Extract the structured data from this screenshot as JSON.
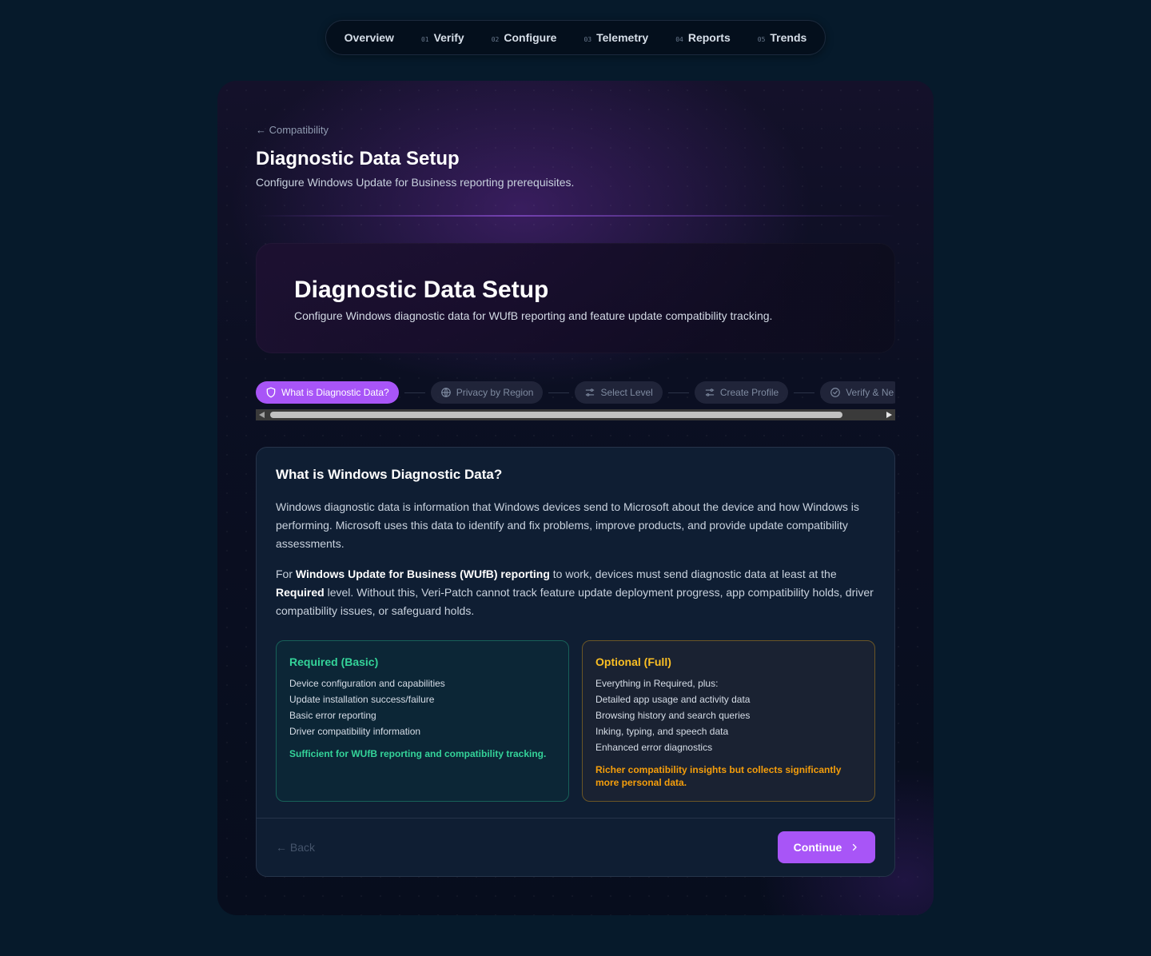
{
  "topnav": {
    "items": [
      {
        "num": "",
        "label": "Overview"
      },
      {
        "num": "01",
        "label": "Verify"
      },
      {
        "num": "02",
        "label": "Configure"
      },
      {
        "num": "03",
        "label": "Telemetry"
      },
      {
        "num": "04",
        "label": "Reports"
      },
      {
        "num": "05",
        "label": "Trends"
      }
    ]
  },
  "header": {
    "breadcrumb": "← Compatibility",
    "title": "Diagnostic Data Setup",
    "subtitle": "Configure Windows Update for Business reporting prerequisites."
  },
  "hero": {
    "title": "Diagnostic Data Setup",
    "subtitle": "Configure Windows diagnostic data for WUfB reporting and feature update compatibility tracking."
  },
  "stepper": {
    "steps": [
      {
        "label": "What is Diagnostic Data?",
        "icon": "shield-icon",
        "active": true
      },
      {
        "label": "Privacy by Region",
        "icon": "globe-icon",
        "active": false
      },
      {
        "label": "Select Level",
        "icon": "sliders-icon",
        "active": false
      },
      {
        "label": "Create Profile",
        "icon": "sliders-icon",
        "active": false
      },
      {
        "label": "Verify & Ne",
        "icon": "check-circle-icon",
        "active": false
      }
    ]
  },
  "panel": {
    "heading": "What is Windows Diagnostic Data?",
    "para1": "Windows diagnostic data is information that Windows devices send to Microsoft about the device and how Windows is performing. Microsoft uses this data to identify and fix problems, improve products, and provide update compatibility assessments.",
    "para2": {
      "t1": "For ",
      "b1": "Windows Update for Business (WUfB) reporting",
      "t2": " to work, devices must send diagnostic data at least at the ",
      "b2": "Required",
      "t3": " level. Without this, Veri-Patch cannot track feature update deployment progress, app compatibility holds, driver compatibility issues, or safeguard holds."
    },
    "required": {
      "title": "Required (Basic)",
      "items": [
        "Device configuration and capabilities",
        "Update installation success/failure",
        "Basic error reporting",
        "Driver compatibility information"
      ],
      "note": "Sufficient for WUfB reporting and compatibility tracking."
    },
    "optional": {
      "title": "Optional (Full)",
      "items": [
        "Everything in Required, plus:",
        "Detailed app usage and activity data",
        "Browsing history and search queries",
        "Inking, typing, and speech data",
        "Enhanced error diagnostics"
      ],
      "note": "Richer compatibility insights but collects significantly more personal data."
    },
    "back_label": "← Back",
    "continue_label": "Continue"
  },
  "colors": {
    "accent": "#a855f7",
    "required": "#34d399",
    "optional": "#fbbf24",
    "background": "#061a2b"
  }
}
